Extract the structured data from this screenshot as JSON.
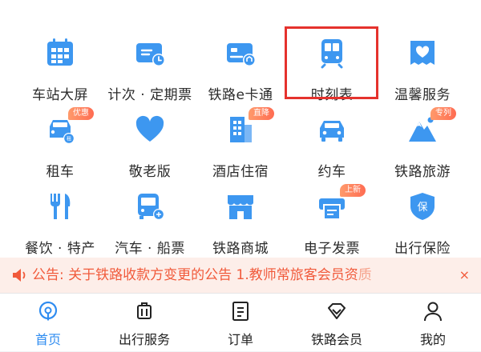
{
  "colors": {
    "accent_blue": "#2f8cf0",
    "icon_blue": "#3d97f0",
    "badge_orange": "#ff6c52",
    "highlight_red": "#e5322d",
    "notice_text": "#f15a3b",
    "notice_bg": "#fdeee9"
  },
  "services": [
    {
      "label": "车站大屏",
      "icon": "calendar-grid-icon",
      "badge": ""
    },
    {
      "label": "计次 · 定期票",
      "icon": "ticket-card-clock-icon",
      "badge": ""
    },
    {
      "label": "铁路e卡通",
      "icon": "e-card-icon",
      "badge": ""
    },
    {
      "label": "时刻表",
      "icon": "train-front-icon",
      "badge": ""
    },
    {
      "label": "温馨服务",
      "icon": "heart-box-icon",
      "badge": ""
    },
    {
      "label": "租车",
      "icon": "rental-car-icon",
      "badge": "优惠"
    },
    {
      "label": "敬老版",
      "icon": "heart-icon",
      "badge": ""
    },
    {
      "label": "酒店住宿",
      "icon": "hotel-building-icon",
      "badge": "直降"
    },
    {
      "label": "约车",
      "icon": "car-icon",
      "badge": ""
    },
    {
      "label": "铁路旅游",
      "icon": "mountain-icon",
      "badge": "专列"
    },
    {
      "label": "餐饮 · 特产",
      "icon": "fork-knife-icon",
      "badge": ""
    },
    {
      "label": "汽车 · 船票",
      "icon": "bus-icon",
      "badge": ""
    },
    {
      "label": "铁路商城",
      "icon": "shop-icon",
      "badge": ""
    },
    {
      "label": "电子发票",
      "icon": "invoice-printer-icon",
      "badge": "上新"
    },
    {
      "label": "出行保险",
      "icon": "insurance-shield-icon",
      "badge": ""
    }
  ],
  "notice": {
    "icon": "speaker-icon",
    "prefix": "公告: ",
    "text": "关于铁路收款方变更的公告  1.教师常旅客会员资",
    "fade": "质",
    "close": "×"
  },
  "tabs": [
    {
      "label": "首页",
      "icon": "home-train-icon",
      "active": true
    },
    {
      "label": "出行服务",
      "icon": "luggage-icon",
      "active": false
    },
    {
      "label": "订单",
      "icon": "order-list-icon",
      "active": false
    },
    {
      "label": "铁路会员",
      "icon": "diamond-icon",
      "active": false
    },
    {
      "label": "我的",
      "icon": "user-icon",
      "active": false
    }
  ]
}
